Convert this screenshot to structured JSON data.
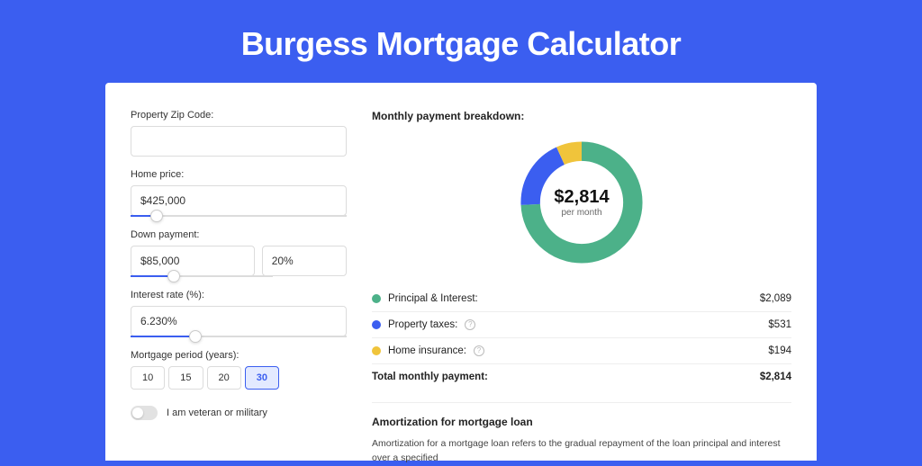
{
  "page_title": "Burgess Mortgage Calculator",
  "form": {
    "zip_label": "Property Zip Code:",
    "zip_value": "",
    "home_price_label": "Home price:",
    "home_price_value": "$425,000",
    "home_price_slider_pct": 12,
    "down_payment_label": "Down payment:",
    "down_payment_value": "$85,000",
    "down_payment_pct_value": "20%",
    "down_payment_slider_pct": 20,
    "interest_label": "Interest rate (%):",
    "interest_value": "6.230%",
    "interest_slider_pct": 30,
    "period_label": "Mortgage period (years):",
    "periods": [
      "10",
      "15",
      "20",
      "30"
    ],
    "period_selected": "30",
    "veteran_label": "I am veteran or military"
  },
  "breakdown": {
    "title": "Monthly payment breakdown:",
    "donut_value": "$2,814",
    "donut_sub": "per month",
    "items": [
      {
        "label": "Principal & Interest:",
        "value": "$2,089",
        "color": "green",
        "info": false
      },
      {
        "label": "Property taxes:",
        "value": "$531",
        "color": "blue",
        "info": true
      },
      {
        "label": "Home insurance:",
        "value": "$194",
        "color": "yellow",
        "info": true
      }
    ],
    "total_label": "Total monthly payment:",
    "total_value": "$2,814"
  },
  "amortization": {
    "title": "Amortization for mortgage loan",
    "body": "Amortization for a mortgage loan refers to the gradual repayment of the loan principal and interest over a specified"
  },
  "chart_data": {
    "type": "pie",
    "title": "Monthly payment breakdown",
    "series": [
      {
        "name": "Principal & Interest",
        "value": 2089,
        "color": "#4cb189"
      },
      {
        "name": "Property taxes",
        "value": 531,
        "color": "#3b5ef0"
      },
      {
        "name": "Home insurance",
        "value": 194,
        "color": "#f0c43b"
      }
    ],
    "total": 2814,
    "center_label": "$2,814 per month"
  }
}
